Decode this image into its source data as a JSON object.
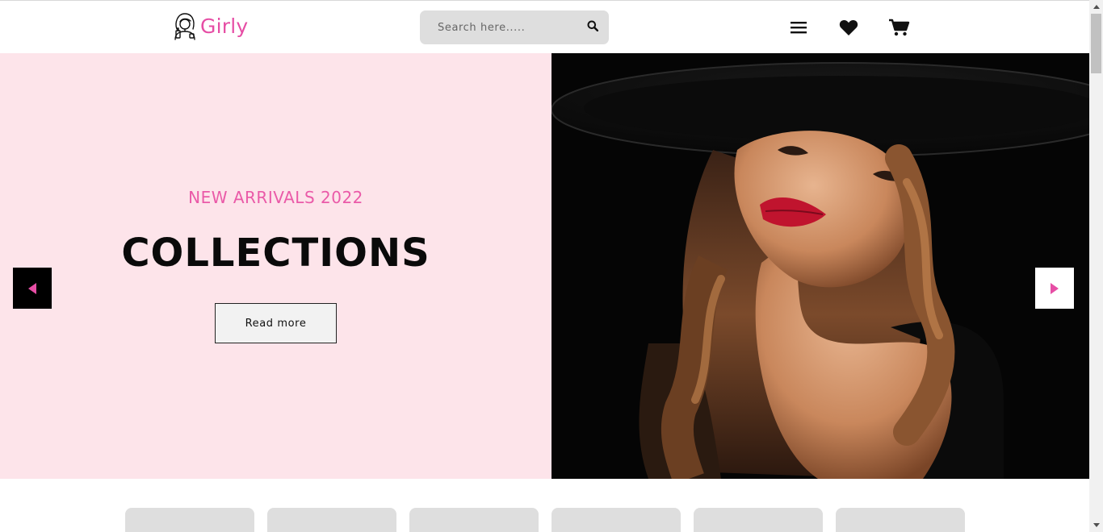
{
  "header": {
    "brand": "Girly",
    "search": {
      "placeholder": "Search here.....",
      "value": ""
    },
    "icons": [
      "user-girl-logo-icon",
      "search-icon",
      "menu-icon",
      "heart-icon",
      "cart-icon"
    ]
  },
  "hero": {
    "subtitle": "NEW ARRIVALS 2022",
    "title": "COLLECTIONS",
    "button_label": "Read more",
    "image": "woman-in-black-hat-photo"
  },
  "colors": {
    "brand_pink": "#e64ea5",
    "hero_background": "#fde4ea",
    "search_background": "#dedede"
  },
  "categories": {
    "tile_count": 6
  }
}
